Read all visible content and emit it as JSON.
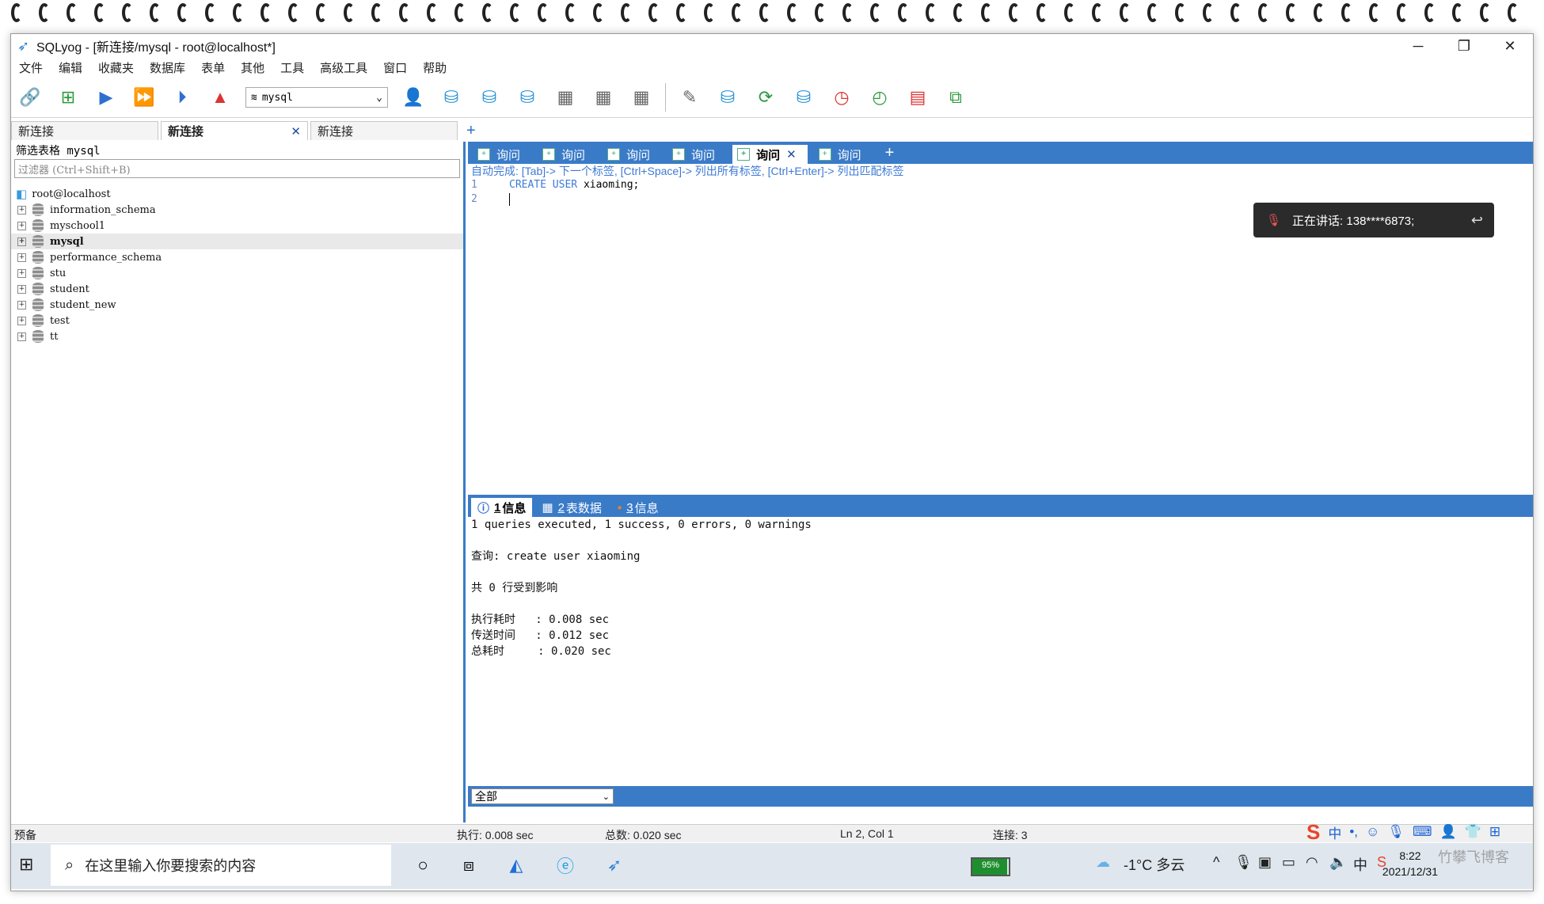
{
  "window": {
    "title": "SQLyog - [新连接/mysql - root@localhost*]",
    "controls": {
      "minimize": "─",
      "maximize": "❐",
      "close": "✕"
    }
  },
  "menu": [
    "文件",
    "编辑",
    "收藏夹",
    "数据库",
    "表单",
    "其他",
    "工具",
    "高级工具",
    "窗口",
    "帮助"
  ],
  "toolbar": {
    "db_select": "mysql"
  },
  "connection_tabs": [
    {
      "label": "新连接",
      "active": false
    },
    {
      "label": "新连接",
      "active": true,
      "close": "✕"
    },
    {
      "label": "新连接",
      "active": false
    }
  ],
  "connection_add": "+",
  "left": {
    "filter_title": "筛选表格 mysql",
    "filter_placeholder": "过滤器 (Ctrl+Shift+B)",
    "root": "root@localhost",
    "databases": [
      "information_schema",
      "myschool1",
      "mysql",
      "performance_schema",
      "stu",
      "student",
      "student_new",
      "test",
      "tt"
    ],
    "selected_db": "mysql"
  },
  "query_tabs": [
    {
      "label": "询问"
    },
    {
      "label": "询问"
    },
    {
      "label": "询问"
    },
    {
      "label": "询问"
    },
    {
      "label": "询问",
      "active": true,
      "close": "✕"
    },
    {
      "label": "询问"
    }
  ],
  "query_add": "+",
  "editor": {
    "hint": "自动完成: [Tab]-> 下一个标签, [Ctrl+Space]-> 列出所有标签, [Ctrl+Enter]-> 列出匹配标签",
    "lines": [
      {
        "num": "1",
        "kw1": "CREATE",
        "kw2": "USER",
        "rest": "xiaoming;"
      },
      {
        "num": "2"
      }
    ]
  },
  "call_popup": {
    "text": "正在讲话: 138****6873;"
  },
  "result_tabs": [
    {
      "num": "1",
      "label": "信息",
      "active": true
    },
    {
      "num": "2",
      "label": "表数据"
    },
    {
      "num": "3",
      "label": "信息"
    }
  ],
  "results": [
    "1 queries executed, 1 success, 0 errors, 0 warnings",
    "",
    "查询: create user xiaoming",
    "",
    "共 0 行受到影响",
    "",
    "执行耗时   : 0.008 sec",
    "传送时间   : 0.012 sec",
    "总耗时     : 0.020 sec"
  ],
  "bottom_combo": "全部",
  "status": {
    "ready": "预备",
    "exec": "执行: 0.008 sec",
    "total": "总数: 0.020 sec",
    "pos": "Ln 2, Col 1",
    "conn": "连接: 3"
  },
  "taskbar": {
    "search_placeholder": "在这里输入你要搜索的内容",
    "battery": "95%",
    "battery_level": 0.95,
    "weather": "-1°C 多云",
    "ime_mode": "中",
    "time": "8:22",
    "date": "2021/12/31",
    "watermark": "竹攀飞博客"
  }
}
